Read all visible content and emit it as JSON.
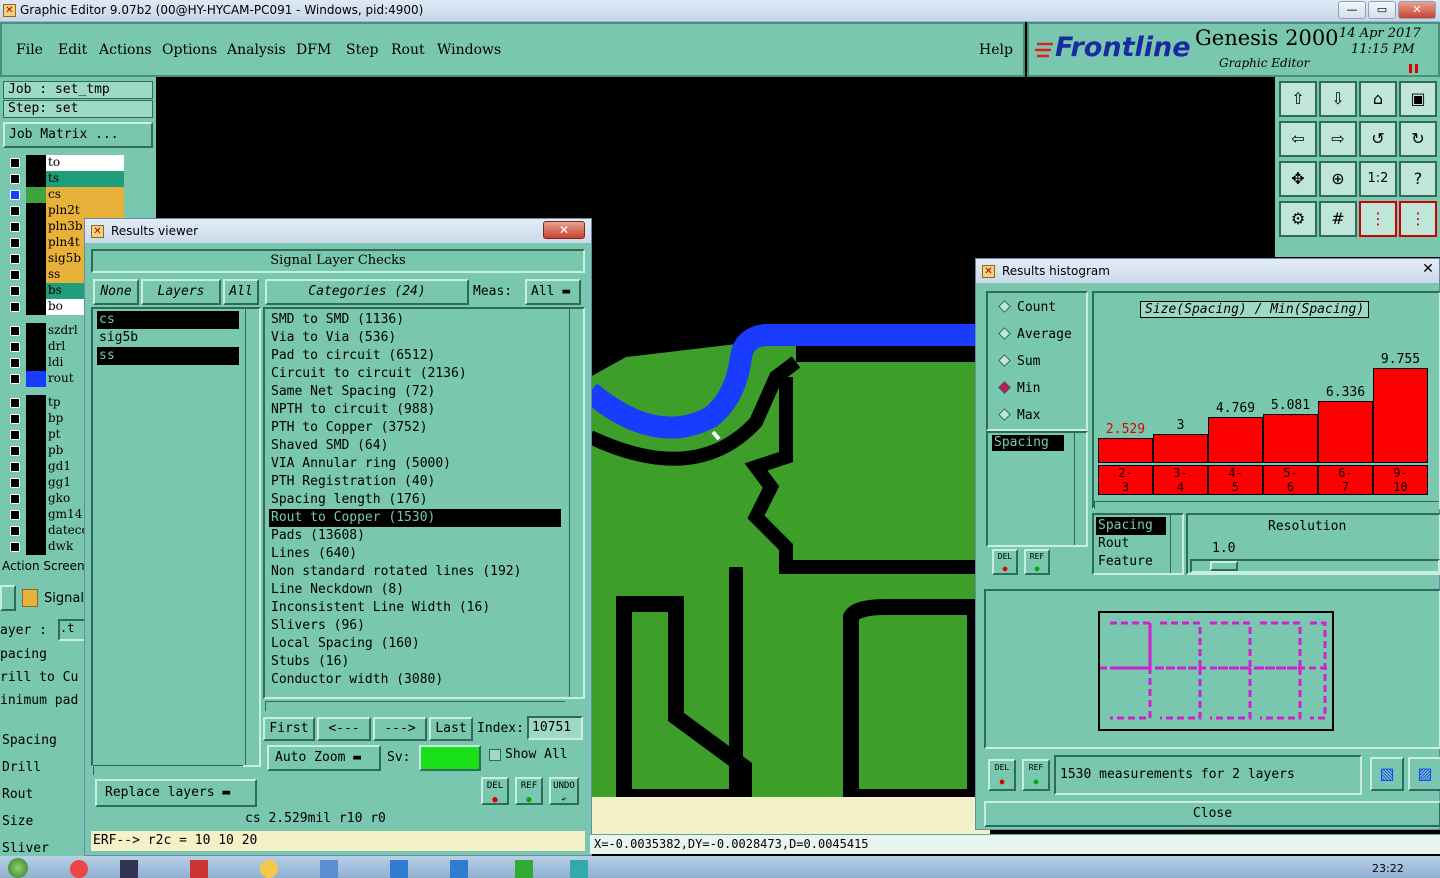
{
  "window": {
    "title": "Graphic Editor 9.07b2 (00@HY-HYCAM-PC091 - Windows, pid:4900)",
    "controls": [
      "—",
      "▭",
      "✕"
    ]
  },
  "menu": {
    "items": [
      "File",
      "Edit",
      "Actions",
      "Options",
      "Analysis",
      "DFM",
      "Step",
      "Rout",
      "Windows"
    ],
    "help": "Help"
  },
  "brand": {
    "logo": "Frontline",
    "product": "Genesis 2000",
    "subtitle": "Graphic Editor",
    "date": "14 Apr 2017",
    "time": "11:15 PM"
  },
  "left_panel": {
    "job": "Job : set_tmp",
    "step": "Step: set",
    "job_matrix": "Job Matrix ...",
    "layers": [
      {
        "name": "to",
        "bg": "#ffffff",
        "swatch": "#000000",
        "checked": false
      },
      {
        "name": "ts",
        "bg": "#1e9e7a",
        "swatch": "#000000",
        "checked": false
      },
      {
        "name": "cs",
        "bg": "#e8b23a",
        "swatch": "#3fa33f",
        "checked": true
      },
      {
        "name": "pln2t",
        "bg": "#e8b23a",
        "swatch": "#000000",
        "checked": false
      },
      {
        "name": "pln3b",
        "bg": "#e8b23a",
        "swatch": "#000000",
        "checked": false
      },
      {
        "name": "pln4t",
        "bg": "#e8b23a",
        "swatch": "#000000",
        "checked": false
      },
      {
        "name": "sig5b",
        "bg": "#e8b23a",
        "swatch": "#000000",
        "checked": false
      },
      {
        "name": "ss",
        "bg": "#e8b23a",
        "swatch": "#000000",
        "checked": false
      },
      {
        "name": "bs",
        "bg": "#1e9e7a",
        "swatch": "#000000",
        "checked": false
      },
      {
        "name": "bo",
        "bg": "#ffffff",
        "swatch": "#000000",
        "checked": false
      },
      {
        "name": "szdrl",
        "bg": "#79c7ae",
        "swatch": "#000000",
        "checked": false
      },
      {
        "name": "drl",
        "bg": "#79c7ae",
        "swatch": "#000000",
        "checked": false
      },
      {
        "name": "ldi",
        "bg": "#79c7ae",
        "swatch": "#000000",
        "checked": false
      },
      {
        "name": "rout",
        "bg": "#79c7ae",
        "swatch": "#1a3cff",
        "checked": false
      },
      {
        "name": "tp",
        "bg": "#79c7ae",
        "swatch": "#000000",
        "checked": false
      },
      {
        "name": "bp",
        "bg": "#79c7ae",
        "swatch": "#000000",
        "checked": false
      },
      {
        "name": "pt",
        "bg": "#79c7ae",
        "swatch": "#000000",
        "checked": false
      },
      {
        "name": "pb",
        "bg": "#79c7ae",
        "swatch": "#000000",
        "checked": false
      },
      {
        "name": "gd1",
        "bg": "#79c7ae",
        "swatch": "#000000",
        "checked": false
      },
      {
        "name": "gg1",
        "bg": "#79c7ae",
        "swatch": "#000000",
        "checked": false
      },
      {
        "name": "gko",
        "bg": "#79c7ae",
        "swatch": "#000000",
        "checked": false
      },
      {
        "name": "gm14",
        "bg": "#79c7ae",
        "swatch": "#000000",
        "checked": false
      },
      {
        "name": "datecc",
        "bg": "#79c7ae",
        "swatch": "#000000",
        "checked": false
      },
      {
        "name": "dwk",
        "bg": "#79c7ae",
        "swatch": "#000000",
        "checked": false
      }
    ],
    "action_screen": "Action Screen",
    "signal_tab": "Signal",
    "layer_field": "ayer :",
    "layer_value": ".t",
    "fragments": [
      "pacing",
      "rill to Cu",
      "inimum pad"
    ],
    "checks": [
      "Spacing",
      "Drill",
      "Rout",
      "Size",
      "Sliver"
    ]
  },
  "results_viewer": {
    "title": "Results viewer",
    "header": "Signal Layer Checks",
    "none_btn": "None",
    "layers_btn": "Layers",
    "all_btn": "All",
    "categories_btn": "Categories (24)",
    "meas_label": "Meas:",
    "meas_value": "All",
    "layer_list": [
      {
        "name": "cs",
        "selected": true
      },
      {
        "name": "sig5b",
        "selected": false
      },
      {
        "name": "ss",
        "selected": true
      }
    ],
    "categories": [
      {
        "label": "SMD to SMD (1136)",
        "selected": false
      },
      {
        "label": "Via to Via (536)",
        "selected": false
      },
      {
        "label": "Pad to circuit (6512)",
        "selected": false
      },
      {
        "label": "Circuit to circuit (2136)",
        "selected": false
      },
      {
        "label": "Same Net Spacing (72)",
        "selected": false
      },
      {
        "label": "NPTH to circuit (988)",
        "selected": false
      },
      {
        "label": "PTH to Copper (3752)",
        "selected": false
      },
      {
        "label": "Shaved SMD (64)",
        "selected": false
      },
      {
        "label": "VIA Annular ring (5000)",
        "selected": false
      },
      {
        "label": "PTH Registration (40)",
        "selected": false
      },
      {
        "label": "Spacing length (176)",
        "selected": false
      },
      {
        "label": "Rout to Copper (1530)",
        "selected": true
      },
      {
        "label": "Pads (13608)",
        "selected": false
      },
      {
        "label": "Lines (640)",
        "selected": false
      },
      {
        "label": "Non standard rotated lines (192)",
        "selected": false
      },
      {
        "label": "Line Neckdown (8)",
        "selected": false
      },
      {
        "label": "Inconsistent Line Width (16)",
        "selected": false
      },
      {
        "label": "Slivers (96)",
        "selected": false
      },
      {
        "label": "Local Spacing (160)",
        "selected": false
      },
      {
        "label": "Stubs (16)",
        "selected": false
      },
      {
        "label": "Conductor width (3080)",
        "selected": false
      }
    ],
    "nav": {
      "first": "First",
      "prev": "<---",
      "next": "--->",
      "last": "Last",
      "index_label": "Index:",
      "index_value": "10751"
    },
    "auto_zoom": "Auto Zoom",
    "sv_label": "Sv:",
    "show_all": "Show All",
    "replace_layers": "Replace layers",
    "del": "DEL",
    "ref": "REF",
    "undo": "UNDO",
    "status": "cs 2.529mil  r10  r0",
    "erf": "ERF--> r2c = 10 10 20"
  },
  "histogram": {
    "title": "Results histogram",
    "modes": [
      {
        "label": "Count",
        "selected": false
      },
      {
        "label": "Average",
        "selected": false
      },
      {
        "label": "Sum",
        "selected": false
      },
      {
        "label": "Min",
        "selected": true
      },
      {
        "label": "Max",
        "selected": false
      }
    ],
    "list": [
      "Spacing"
    ],
    "chart_title": "Size(Spacing) / Min(Spacing)",
    "bars": [
      {
        "value": "2.529",
        "height": 0.18,
        "bin": [
          "2-",
          "3"
        ],
        "label_color": "#e00000"
      },
      {
        "value": "3",
        "height": 0.21,
        "bin": [
          "3-",
          "4"
        ],
        "label_color": "#000000"
      },
      {
        "value": "4.769",
        "height": 0.33,
        "bin": [
          "4-",
          "5"
        ],
        "label_color": "#000000"
      },
      {
        "value": "5.081",
        "height": 0.35,
        "bin": [
          "5-",
          "6"
        ],
        "label_color": "#000000"
      },
      {
        "value": "6.336",
        "height": 0.44,
        "bin": [
          "6-",
          "7"
        ],
        "label_color": "#000000"
      },
      {
        "value": "9.755",
        "height": 0.68,
        "bin": [
          "9-",
          "10"
        ],
        "label_color": "#000000"
      }
    ],
    "attr_list": [
      {
        "label": "Spacing",
        "selected": true
      },
      {
        "label": "Rout",
        "selected": false
      },
      {
        "label": "Feature",
        "selected": false
      }
    ],
    "resolution_label": "Resolution",
    "resolution_value": "1.0",
    "measurements": "1530 measurements for 2 layers",
    "close": "Close",
    "del": "DEL",
    "ref": "REF"
  },
  "status_bar": {
    "coords": "X=-0.0035382,DY=-0.0028473,D=0.0045415"
  },
  "taskbar": {
    "clock": "23:22"
  },
  "colors": {
    "panel": "#79c7ae",
    "copper": "#3d9e2a",
    "rout": "#1a3cff",
    "histogram_bar": "#ff0000"
  }
}
